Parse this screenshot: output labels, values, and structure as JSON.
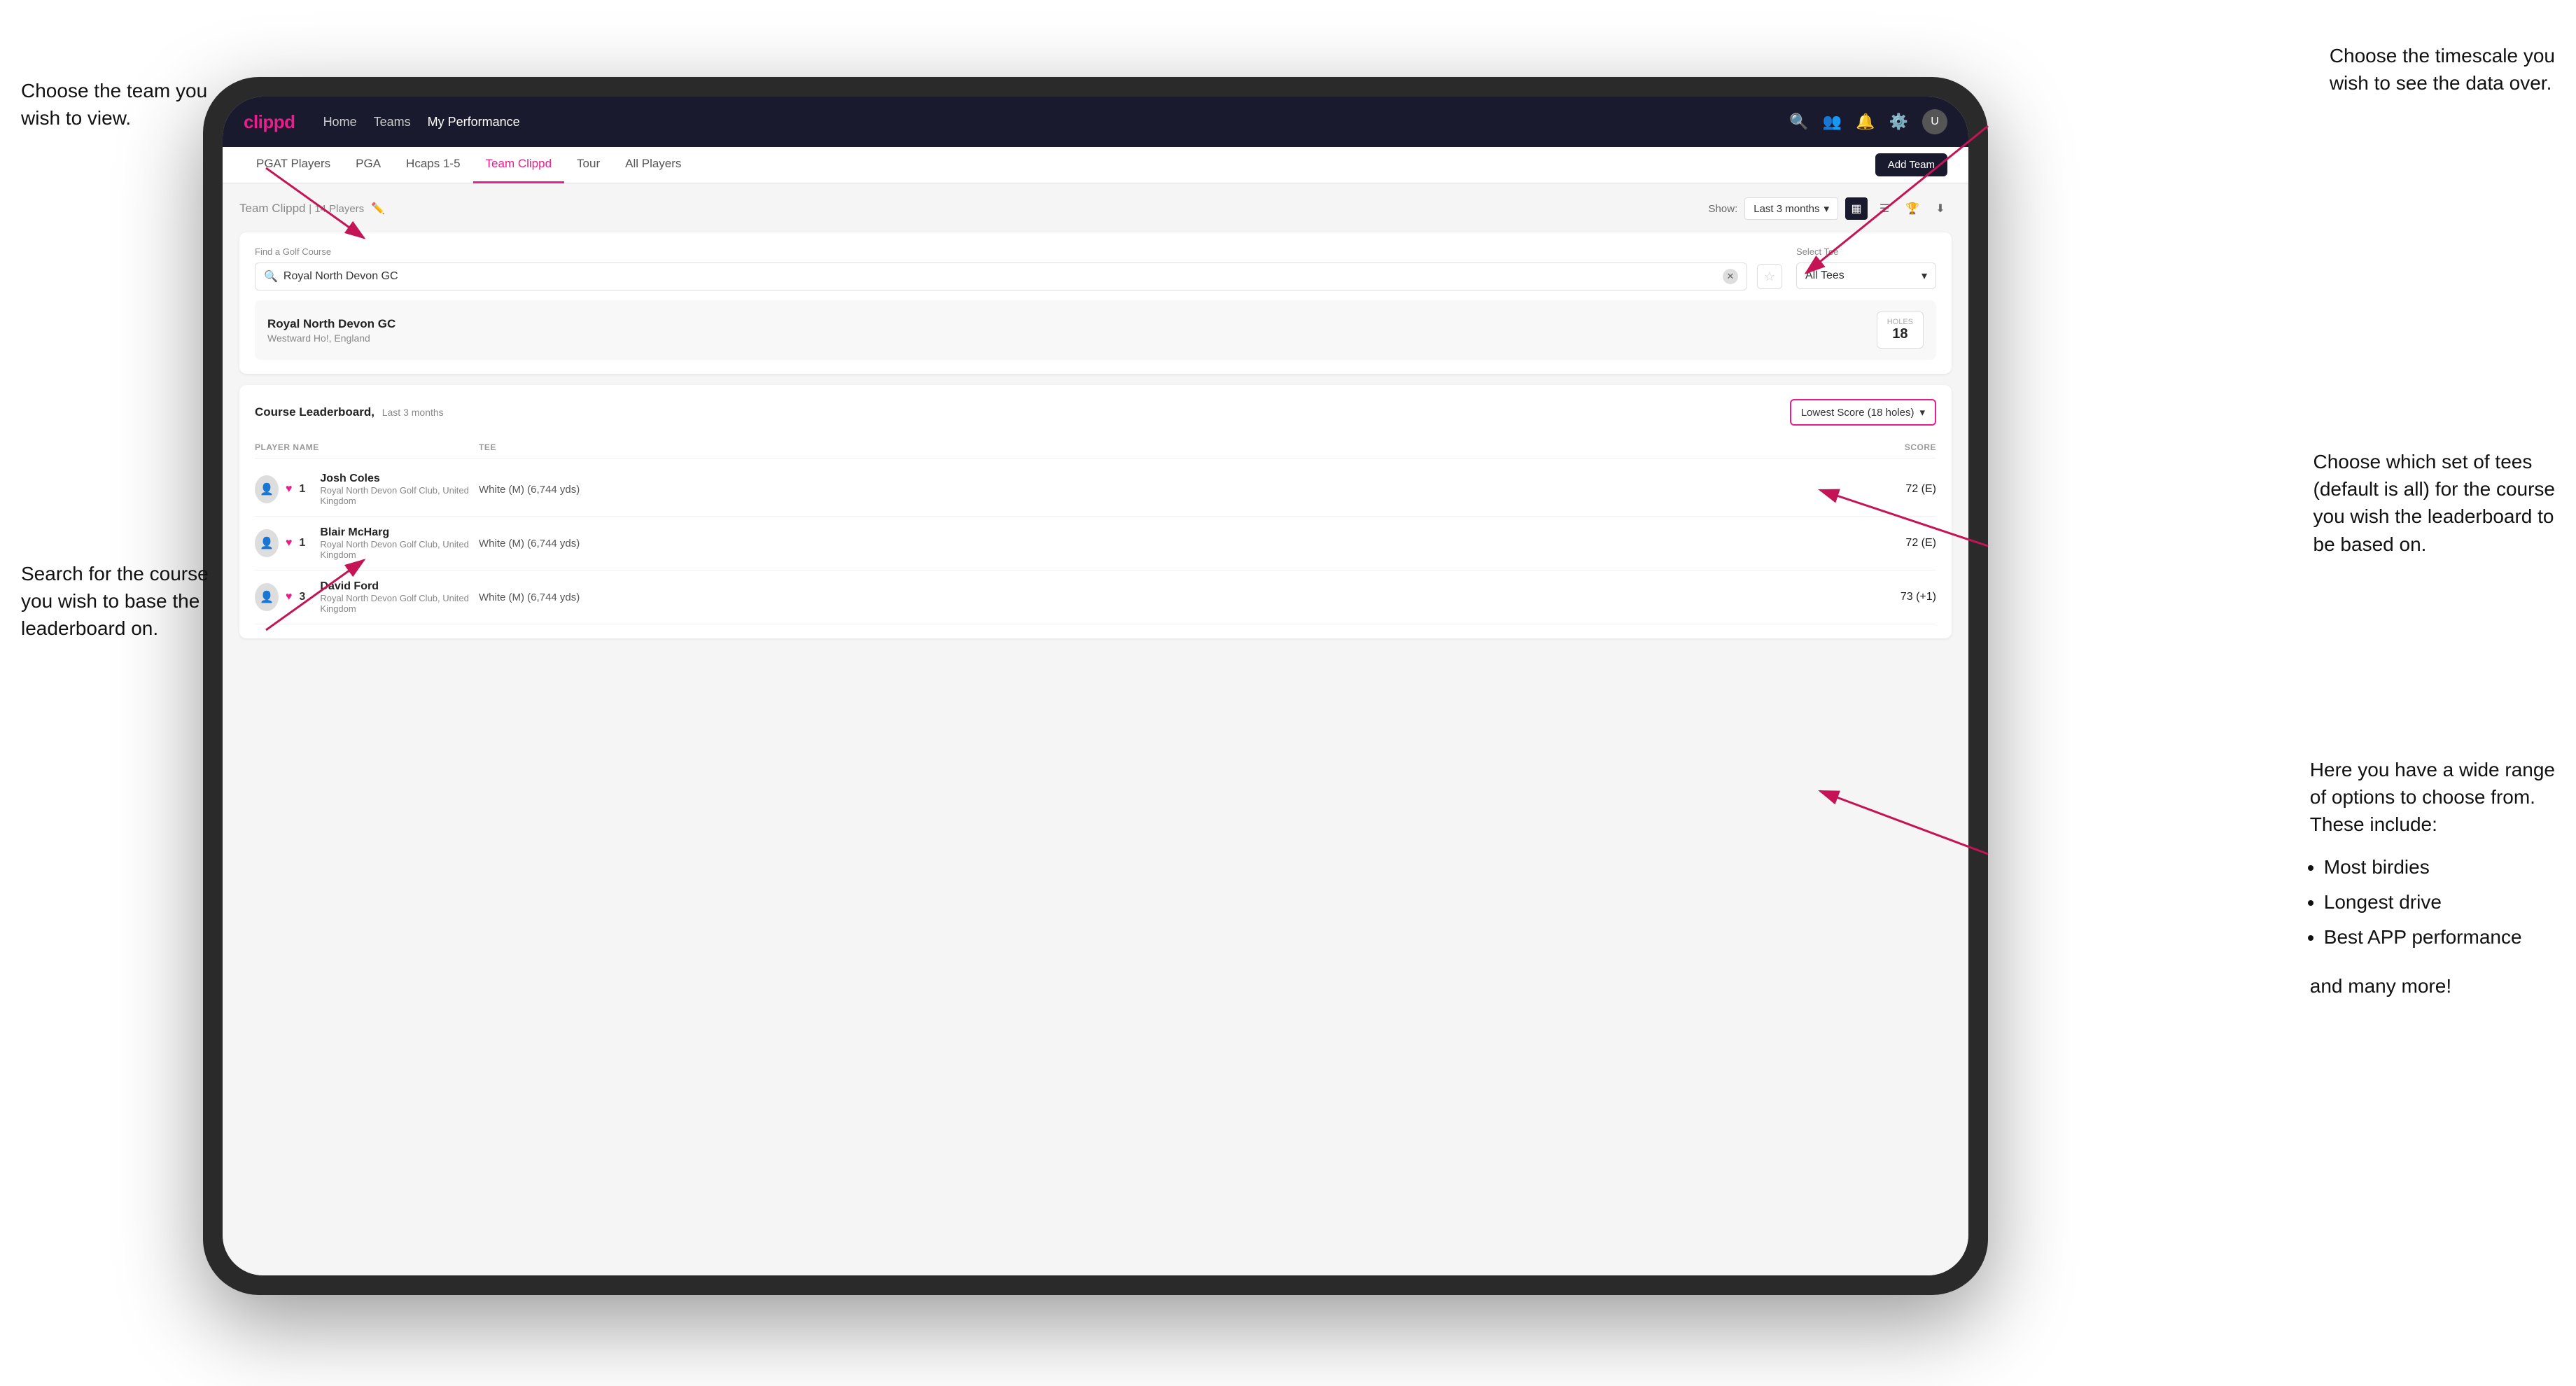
{
  "annotations": {
    "top_left_title": "Choose the team you\nwish to view.",
    "top_right_title": "Choose the timescale you\nwish to see the data over.",
    "middle_left_title": "Search for the course\nyou wish to base the\nleaderboard on.",
    "right_middle_title": "Choose which set of tees\n(default is all) for the course\nyou wish the leaderboard to\nbe based on.",
    "bottom_right_title": "Here you have a wide range\nof options to choose from.\nThese include:",
    "bullet_items": [
      "Most birdies",
      "Longest drive",
      "Best APP performance"
    ],
    "and_more": "and many more!"
  },
  "nav": {
    "logo": "clippd",
    "links": [
      "Home",
      "Teams",
      "My Performance"
    ],
    "active_link": "My Performance"
  },
  "sub_nav": {
    "items": [
      "PGAT Players",
      "PGA",
      "Hcaps 1-5",
      "Team Clippd",
      "Tour",
      "All Players"
    ],
    "active_item": "Team Clippd",
    "add_team_label": "Add Team"
  },
  "team_header": {
    "title": "Team Clippd",
    "player_count": "14 Players",
    "show_label": "Show:",
    "show_value": "Last 3 months"
  },
  "course_search": {
    "find_label": "Find a Golf Course",
    "search_value": "Royal North Devon GC",
    "select_tee_label": "Select Tee",
    "tee_value": "All Tees"
  },
  "course_result": {
    "name": "Royal North Devon GC",
    "location": "Westward Ho!, England",
    "holes_label": "Holes",
    "holes_count": "18"
  },
  "leaderboard": {
    "title": "Course Leaderboard,",
    "subtitle": "Last 3 months",
    "score_type": "Lowest Score (18 holes)",
    "columns": {
      "player": "PLAYER NAME",
      "tee": "TEE",
      "score": "SCORE"
    },
    "rows": [
      {
        "rank": "1",
        "name": "Josh Coles",
        "club": "Royal North Devon Golf Club, United Kingdom",
        "tee": "White (M) (6,744 yds)",
        "score": "72 (E)"
      },
      {
        "rank": "1",
        "name": "Blair McHarg",
        "club": "Royal North Devon Golf Club, United Kingdom",
        "tee": "White (M) (6,744 yds)",
        "score": "72 (E)"
      },
      {
        "rank": "3",
        "name": "David Ford",
        "club": "Royal North Devon Golf Club, United Kingdom",
        "tee": "White (M) (6,744 yds)",
        "score": "73 (+1)"
      }
    ]
  },
  "colors": {
    "brand_pink": "#e91e8c",
    "nav_bg": "#1a1a2e",
    "arrow_color": "#c41455"
  }
}
